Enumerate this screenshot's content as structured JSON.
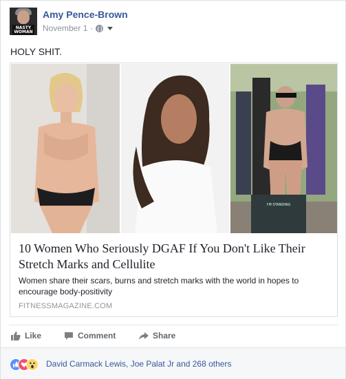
{
  "post": {
    "author": "Amy Pence-Brown",
    "date": "November 1",
    "separator": "·",
    "privacy_icon": "globe-icon",
    "avatar_text": "NASTY WOMAN",
    "text": "HOLY SHIT."
  },
  "link": {
    "title": "10 Women Who Seriously DGAF If You Don't Like Their Stretch Marks and Cellulite",
    "description": "Women share their scars, burns and stretch marks with the world in hopes to encourage body-positivity",
    "domain": "FITNESSMAGAZINE.COM"
  },
  "actions": {
    "like": "Like",
    "comment": "Comment",
    "share": "Share"
  },
  "reactions": {
    "icons": [
      "like-icon",
      "love-icon",
      "wow-icon"
    ],
    "text": "David Carmack Lewis, Joe Palat Jr and 268 others"
  },
  "colors": {
    "link_blue": "#365899",
    "meta_gray": "#90949c",
    "like_blue": "#5890ff",
    "love_red": "#f25268",
    "wow_yellow": "#fcd669"
  }
}
